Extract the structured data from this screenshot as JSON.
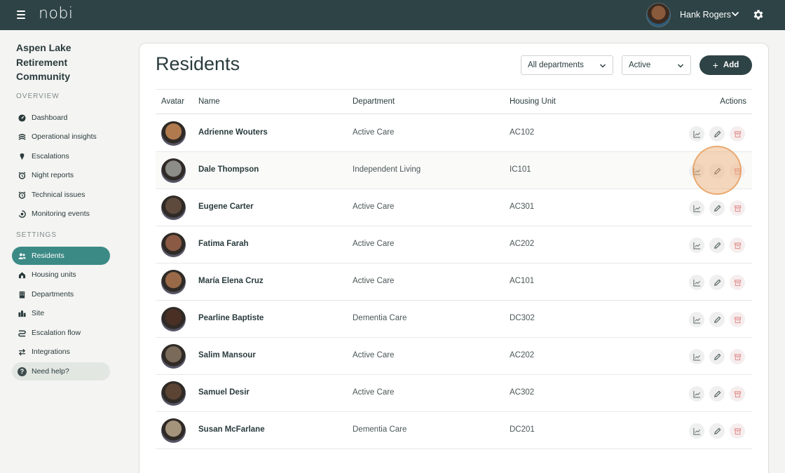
{
  "topbar": {
    "logo": "nobi",
    "user_name": "Hank Rogers",
    "colors": {
      "bar": "#2e4346"
    }
  },
  "sidebar": {
    "org_name": "Aspen Lake Retirement Community",
    "overview_label": "OVERVIEW",
    "settings_label": "SETTINGS",
    "overview_items": [
      {
        "label": "Dashboard",
        "icon": "dashboard-icon"
      },
      {
        "label": "Operational insights",
        "icon": "insights-icon"
      },
      {
        "label": "Escalations",
        "icon": "escalation-icon"
      },
      {
        "label": "Night reports",
        "icon": "alarm-icon"
      },
      {
        "label": "Technical issues",
        "icon": "alarm-icon"
      },
      {
        "label": "Monitoring events",
        "icon": "monitor-icon"
      }
    ],
    "settings_items": [
      {
        "label": "Residents",
        "icon": "users-icon",
        "active": true
      },
      {
        "label": "Housing units",
        "icon": "home-icon"
      },
      {
        "label": "Departments",
        "icon": "building-icon"
      },
      {
        "label": "Site",
        "icon": "site-icon"
      },
      {
        "label": "Escalation flow",
        "icon": "flow-icon"
      },
      {
        "label": "Integrations",
        "icon": "swap-icon"
      }
    ],
    "help_label": "Need help?",
    "accent": "#3c8a86"
  },
  "main": {
    "title": "Residents",
    "department_filter": "All departments",
    "status_filter": "Active",
    "add_label": "Add",
    "columns": [
      "Avatar",
      "Name",
      "Department",
      "Housing Unit",
      "Actions"
    ],
    "residents": [
      {
        "name": "Adrienne Wouters",
        "department": "Active Care",
        "unit": "AC102"
      },
      {
        "name": "Dale Thompson",
        "department": "Independent Living",
        "unit": "IC101"
      },
      {
        "name": "Eugene Carter",
        "department": "Active Care",
        "unit": "AC301"
      },
      {
        "name": "Fatima Farah",
        "department": "Active Care",
        "unit": "AC202"
      },
      {
        "name": "María Elena Cruz",
        "department": "Active Care",
        "unit": "AC101"
      },
      {
        "name": "Pearline Baptiste",
        "department": "Dementia Care",
        "unit": "DC302"
      },
      {
        "name": "Salim Mansour",
        "department": "Active Care",
        "unit": "AC202"
      },
      {
        "name": "Samuel Desir",
        "department": "Active Care",
        "unit": "AC302"
      },
      {
        "name": "Susan McFarlane",
        "department": "Dementia Care",
        "unit": "DC201"
      }
    ],
    "row_actions": [
      "chart-icon",
      "edit-icon",
      "archive-icon"
    ]
  }
}
